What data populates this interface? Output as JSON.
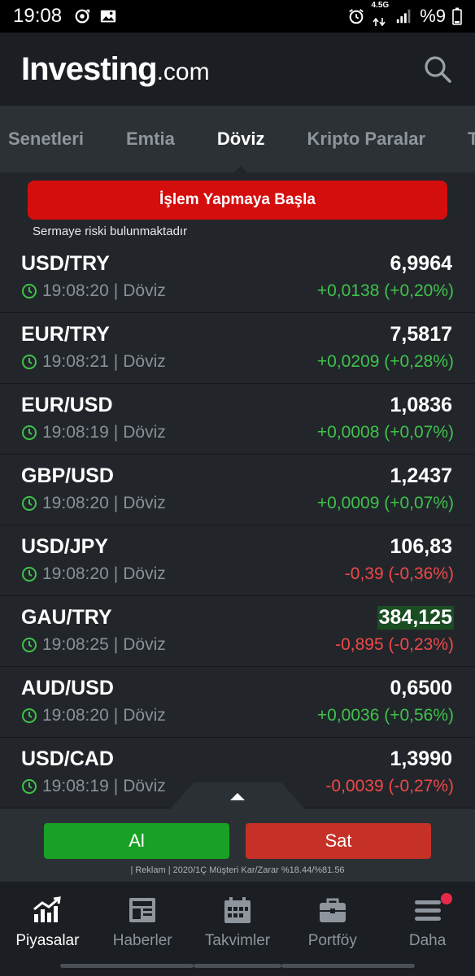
{
  "status_bar": {
    "time": "19:08",
    "network_label_top": "4.5G",
    "battery_text": "%9"
  },
  "header": {
    "logo_main": "Investing",
    "logo_suffix": ".com",
    "search_icon": "search-icon"
  },
  "tabs": [
    {
      "label": "Senetleri",
      "active": false
    },
    {
      "label": "Emtia",
      "active": false
    },
    {
      "label": "Döviz",
      "active": true
    },
    {
      "label": "Kripto Paralar",
      "active": false
    },
    {
      "label": "Ta",
      "active": false
    }
  ],
  "promo": {
    "cta_label": "İşlem Yapmaya Başla",
    "risk_note": "Sermaye riski bulunmaktadır"
  },
  "quotes": [
    {
      "name": "USD/TRY",
      "price": "6,9964",
      "time": "19:08:20",
      "separator": "|",
      "category": "Döviz",
      "change": "+0,0138 (+0,20%)",
      "direction": "up",
      "highlight": false
    },
    {
      "name": "EUR/TRY",
      "price": "7,5817",
      "time": "19:08:21",
      "separator": "|",
      "category": "Döviz",
      "change": "+0,0209 (+0,28%)",
      "direction": "up",
      "highlight": false
    },
    {
      "name": "EUR/USD",
      "price": "1,0836",
      "time": "19:08:19",
      "separator": "|",
      "category": "Döviz",
      "change": "+0,0008 (+0,07%)",
      "direction": "up",
      "highlight": false
    },
    {
      "name": "GBP/USD",
      "price": "1,2437",
      "time": "19:08:20",
      "separator": "|",
      "category": "Döviz",
      "change": "+0,0009 (+0,07%)",
      "direction": "up",
      "highlight": false
    },
    {
      "name": "USD/JPY",
      "price": "106,83",
      "time": "19:08:20",
      "separator": "|",
      "category": "Döviz",
      "change": "-0,39 (-0,36%)",
      "direction": "down",
      "highlight": false
    },
    {
      "name": "GAU/TRY",
      "price": "384,125",
      "time": "19:08:25",
      "separator": "|",
      "category": "Döviz",
      "change": "-0,895 (-0,23%)",
      "direction": "down",
      "highlight": true
    },
    {
      "name": "AUD/USD",
      "price": "0,6500",
      "time": "19:08:20",
      "separator": "|",
      "category": "Döviz",
      "change": "+0,0036 (+0,56%)",
      "direction": "up",
      "highlight": false
    },
    {
      "name": "USD/CAD",
      "price": "1,3990",
      "time": "19:08:19",
      "separator": "|",
      "category": "Döviz",
      "change": "-0,0039 (-0,27%)",
      "direction": "down",
      "highlight": false
    }
  ],
  "trade": {
    "buy_label": "Al",
    "sell_label": "Sat",
    "ad_note": "| Reklam | 2020/1Ç Müşteri Kar/Zarar %18.44/%81.56"
  },
  "bottom_nav": [
    {
      "label": "Piyasalar",
      "icon": "chart-icon",
      "active": true
    },
    {
      "label": "Haberler",
      "icon": "news-icon",
      "active": false
    },
    {
      "label": "Takvimler",
      "icon": "calendar-icon",
      "active": false
    },
    {
      "label": "Portföy",
      "icon": "briefcase-icon",
      "active": false
    },
    {
      "label": "Daha",
      "icon": "menu-icon",
      "active": false,
      "badge": true
    }
  ],
  "colors": {
    "positive": "#3fc24a",
    "negative": "#f04848",
    "cta_red": "#d40d0d",
    "buy_green": "#18a125",
    "sell_red": "#c63127"
  }
}
